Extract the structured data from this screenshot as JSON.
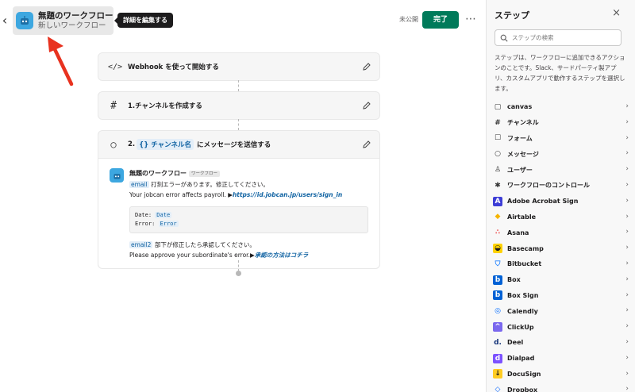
{
  "header": {
    "back_label": "‹",
    "workflow_title": "無題のワークフロー",
    "workflow_subtitle": "新しいワークフロー",
    "tooltip": "詳細を編集する",
    "status": "未公開",
    "done_label": "完了",
    "more_label": "⋯"
  },
  "steps": [
    {
      "icon": "</>",
      "title": "Webhook を使って開始する"
    },
    {
      "icon": "#",
      "title": "1.チャンネルを作成する"
    },
    {
      "icon": "○",
      "title_prefix": "2.",
      "title_chip": "{} チャンネル名",
      "title_suffix": "にメッセージを送信する"
    }
  ],
  "message": {
    "sender": "無題のワークフロー",
    "badge": "ワークフロー",
    "line1_var": "email",
    "line1_text": "打刻エラーがあります。修正してください。",
    "line2_text": "Your jobcan error affects payroll. ▶",
    "line2_link": "https://id.jobcan.jp/users/sign_in",
    "code_date_label": "Date:",
    "code_date_val": "Date",
    "code_error_label": "Error:",
    "code_error_val": "Error",
    "line3_var": "email2",
    "line3_text": "部下が修正したら承認してください。",
    "line4_text": "Please approve your subordinate's error.▶",
    "line4_link": "承認の方法はコチラ"
  },
  "panel": {
    "title": "ステップ",
    "close_label": "×",
    "search_placeholder": "ステップの検索",
    "description": "ステップは、ワークフローに追加できるアクションのことです。Slack、サードパーティ製アプリ、カスタムアプリで動作するステップを選択します。",
    "items": [
      {
        "label": "canvas",
        "icon": "canvas-icon",
        "glyph": "▢",
        "color": "#333333",
        "bg": "transparent"
      },
      {
        "label": "チャンネル",
        "icon": "hash-icon",
        "glyph": "#",
        "color": "#333333",
        "bg": "transparent"
      },
      {
        "label": "フォーム",
        "icon": "form-icon",
        "glyph": "☐",
        "color": "#333333",
        "bg": "transparent"
      },
      {
        "label": "メッセージ",
        "icon": "message-icon",
        "glyph": "○",
        "color": "#333333",
        "bg": "transparent"
      },
      {
        "label": "ユーザー",
        "icon": "user-icon",
        "glyph": "♙",
        "color": "#333333",
        "bg": "transparent"
      },
      {
        "label": "ワークフローのコントロール",
        "icon": "slack-icon",
        "glyph": "✱",
        "color": "#333333",
        "bg": "transparent"
      },
      {
        "label": "Adobe Acrobat Sign",
        "icon": "adobe-sign-icon",
        "glyph": "A",
        "color": "#ffffff",
        "bg": "#3d3dd6"
      },
      {
        "label": "Airtable",
        "icon": "airtable-icon",
        "glyph": "◆",
        "color": "#f5b400",
        "bg": "transparent"
      },
      {
        "label": "Asana",
        "icon": "asana-icon",
        "glyph": "∴",
        "color": "#f06a6a",
        "bg": "transparent"
      },
      {
        "label": "Basecamp",
        "icon": "basecamp-icon",
        "glyph": "◒",
        "color": "#1d1c1d",
        "bg": "#ffd200"
      },
      {
        "label": "Bitbucket",
        "icon": "bitbucket-icon",
        "glyph": "⛉",
        "color": "#2684ff",
        "bg": "transparent"
      },
      {
        "label": "Box",
        "icon": "box-icon",
        "glyph": "b",
        "color": "#ffffff",
        "bg": "#0061d5"
      },
      {
        "label": "Box Sign",
        "icon": "box-sign-icon",
        "glyph": "b",
        "color": "#ffffff",
        "bg": "#0061d5"
      },
      {
        "label": "Calendly",
        "icon": "calendly-icon",
        "glyph": "◎",
        "color": "#006bff",
        "bg": "transparent"
      },
      {
        "label": "ClickUp",
        "icon": "clickup-icon",
        "glyph": "^",
        "color": "#ffffff",
        "bg": "#7b68ee"
      },
      {
        "label": "Deel",
        "icon": "deel-icon",
        "glyph": "d.",
        "color": "#15357a",
        "bg": "transparent"
      },
      {
        "label": "Dialpad",
        "icon": "dialpad-icon",
        "glyph": "d",
        "color": "#ffffff",
        "bg": "#7c52ff"
      },
      {
        "label": "DocuSign",
        "icon": "docusign-icon",
        "glyph": "↓",
        "color": "#1d1c1d",
        "bg": "#ffcc22"
      },
      {
        "label": "Dropbox",
        "icon": "dropbox-icon",
        "glyph": "◇",
        "color": "#0061fe",
        "bg": "transparent"
      }
    ]
  }
}
